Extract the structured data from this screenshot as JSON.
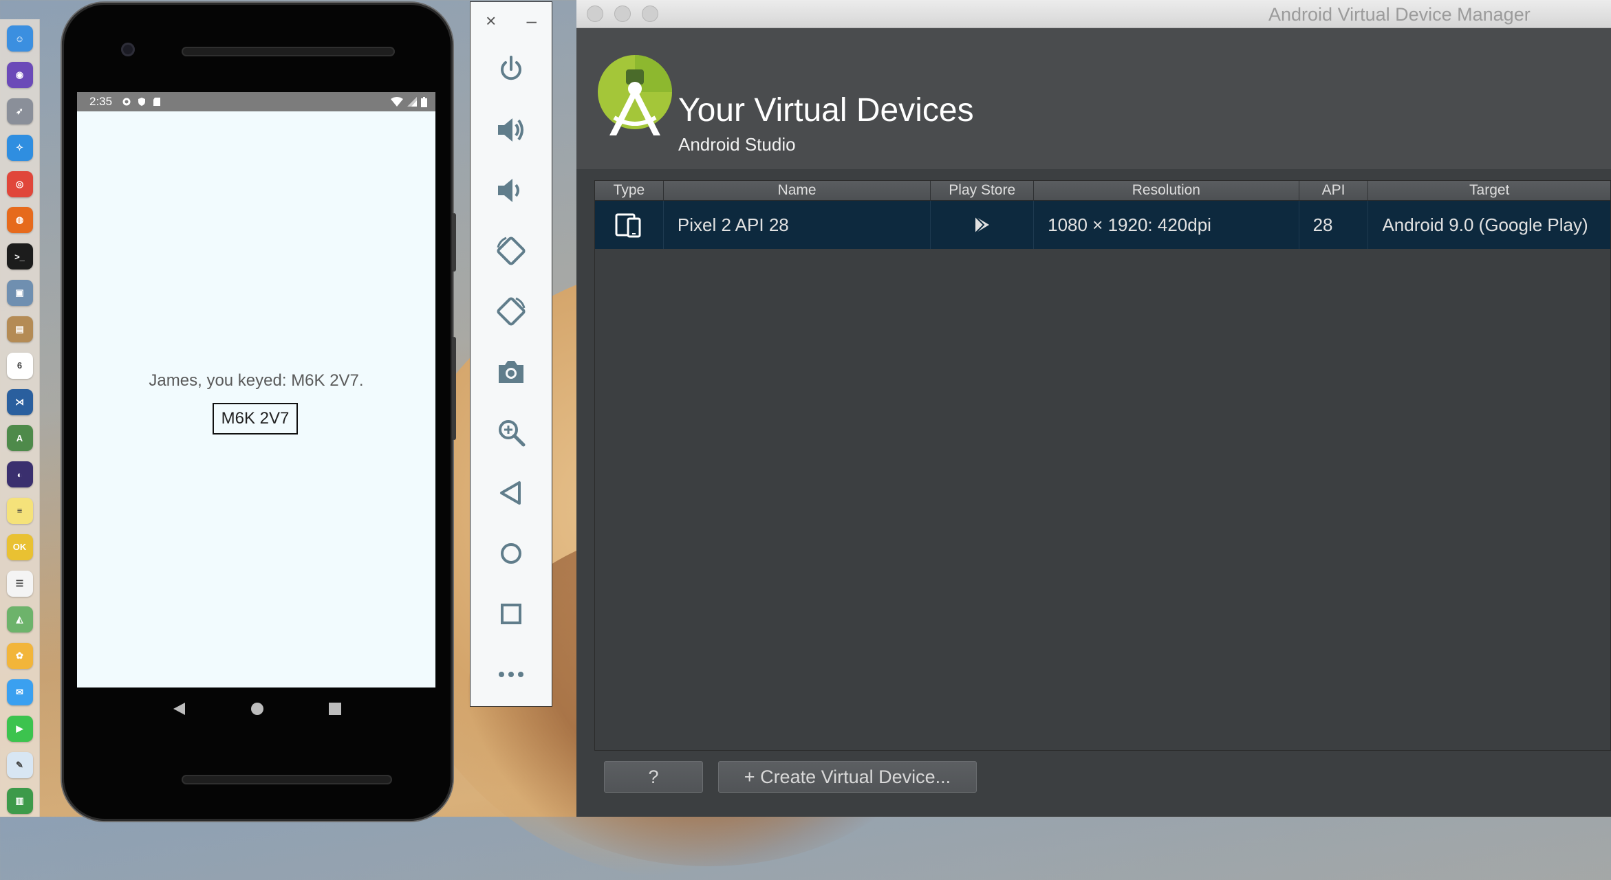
{
  "dock": {
    "apps": [
      {
        "icon": "finder-icon",
        "color": "#3b8fe0",
        "glyph": "☺"
      },
      {
        "icon": "siri-icon",
        "color": "#6b4ab8",
        "glyph": "◉"
      },
      {
        "icon": "launchpad-icon",
        "color": "#8a8f99",
        "glyph": "➶"
      },
      {
        "icon": "safari-icon",
        "color": "#2f8ee0",
        "glyph": "✧"
      },
      {
        "icon": "chrome-icon",
        "color": "#e0463a",
        "glyph": "◎"
      },
      {
        "icon": "firefox-icon",
        "color": "#e66a1c",
        "glyph": "◍"
      },
      {
        "icon": "terminal-icon",
        "color": "#1c1c1c",
        "glyph": ">_"
      },
      {
        "icon": "preview-icon",
        "color": "#6f8fb0",
        "glyph": "▣"
      },
      {
        "icon": "contacts-icon",
        "color": "#b48b55",
        "glyph": "▤"
      },
      {
        "icon": "calendar-icon",
        "color": "#ffffff",
        "glyph": "6"
      },
      {
        "icon": "vscode-icon",
        "color": "#2a5f9e",
        "glyph": "⋊"
      },
      {
        "icon": "android-studio-icon",
        "color": "#4e8a4a",
        "glyph": "A"
      },
      {
        "icon": "github-icon",
        "color": "#3a2f6e",
        "glyph": "◐"
      },
      {
        "icon": "notes-icon",
        "color": "#f5e27a",
        "glyph": "≡"
      },
      {
        "icon": "ok-app-icon",
        "color": "#e9c132",
        "glyph": "OK"
      },
      {
        "icon": "reminders-icon",
        "color": "#f4f4f4",
        "glyph": "☰"
      },
      {
        "icon": "maps-icon",
        "color": "#6db36b",
        "glyph": "◭"
      },
      {
        "icon": "photos-icon",
        "color": "#f2b53a",
        "glyph": "✿"
      },
      {
        "icon": "messages-icon",
        "color": "#3aa0f0",
        "glyph": "✉"
      },
      {
        "icon": "facetime-icon",
        "color": "#3cc34e",
        "glyph": "▶"
      },
      {
        "icon": "textedit-icon",
        "color": "#d8e6f3",
        "glyph": "✎"
      },
      {
        "icon": "numbers-icon",
        "color": "#3d9a4a",
        "glyph": "▥"
      }
    ]
  },
  "phone": {
    "status_time": "2:35",
    "message": "James, you keyed: M6K 2V7.",
    "value_box": "M6K 2V7"
  },
  "emulator": {
    "close": "×",
    "minimize": "–"
  },
  "avd": {
    "window_title": "Android Virtual Device Manager",
    "header_title": "Your Virtual Devices",
    "header_subtitle": "Android Studio",
    "columns": [
      "Type",
      "Name",
      "Play Store",
      "Resolution",
      "API",
      "Target"
    ],
    "devices": [
      {
        "name": "Pixel 2 API 28",
        "resolution": "1080 × 1920: 420dpi",
        "api": "28",
        "target": "Android 9.0 (Google Play)"
      }
    ],
    "help_label": "?",
    "create_label": "+  Create Virtual Device..."
  },
  "colors": {
    "selected_row": "#0d293e",
    "window_bg": "#3c3f41",
    "android_green": "#a4c639"
  }
}
